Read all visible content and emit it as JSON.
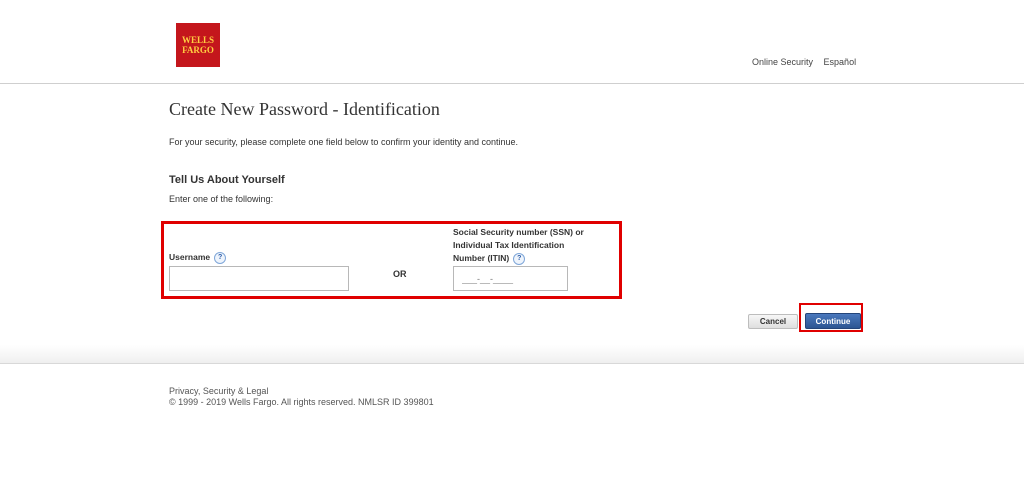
{
  "brand": {
    "logo_line1": "WELLS",
    "logo_line2": "FARGO"
  },
  "top_links": [
    "Online Security",
    "Español"
  ],
  "page": {
    "title": "Create New Password - Identification",
    "intro": "For your security, please complete one field below to confirm your identity and continue.",
    "section_title": "Tell Us About Yourself",
    "section_sub": "Enter one of the following:"
  },
  "form": {
    "username_label": "Username",
    "help_glyph": "?",
    "or_label": "OR",
    "ssn_label_line1": "Social Security number (SSN) or",
    "ssn_label_line2": "Individual Tax Identification",
    "ssn_label_line3": "Number (ITIN)",
    "username_value": "",
    "ssn_placeholder": "___-__-____"
  },
  "buttons": {
    "cancel": "Cancel",
    "continue": "Continue"
  },
  "footer": {
    "link": "Privacy, Security & Legal",
    "copyright": "© 1999 - 2019 Wells Fargo. All rights reserved. NMLSR ID 399801"
  },
  "colors": {
    "brand_red": "#c4161c",
    "brand_gold": "#ffcd41",
    "highlight": "#e00000",
    "primary_button": "#2c5592"
  }
}
